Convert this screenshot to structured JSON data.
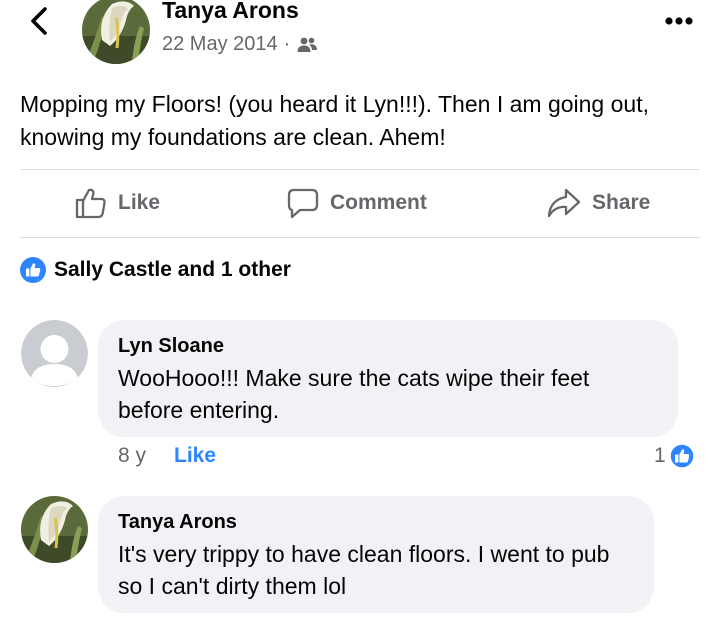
{
  "header": {
    "author_name": "Tanya Arons",
    "date": "22 May 2014",
    "separator": "·",
    "audience_icon": "friends-icon",
    "back_icon": "chevron-left-icon",
    "more_icon": "more-dots-icon"
  },
  "post": {
    "text": "Mopping my Floors!  (you heard it Lyn!!!).  Then I am going out, knowing my foundations are clean.  Ahem!"
  },
  "actions": {
    "like_label": "Like",
    "comment_label": "Comment",
    "share_label": "Share"
  },
  "reactions": {
    "summary": "Sally Castle and 1 other",
    "icon": "like-badge-icon"
  },
  "comments": [
    {
      "author": "Lyn Sloane",
      "text": "WooHooo!!!  Make sure the cats wipe their feet before entering.",
      "age": "8 y",
      "like_label": "Like",
      "reaction_count": "1"
    },
    {
      "author": "Tanya Arons",
      "text": "It's very trippy to have clean floors.  I went to pub so I can't dirty them lol"
    }
  ],
  "colors": {
    "accent_blue": "#2d86ff",
    "secondary_text": "#65676b",
    "bubble_bg": "#f0f2f5",
    "divider": "#dcdee2"
  }
}
